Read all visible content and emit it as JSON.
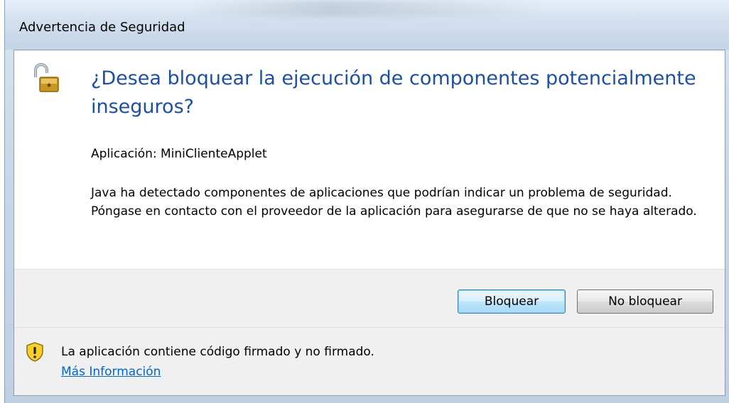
{
  "window": {
    "title": "Advertencia de Seguridad"
  },
  "dialog": {
    "heading": "¿Desea bloquear la ejecución de componentes potencialmente inseguros?",
    "application_line": "Aplicación: MiniClienteApplet",
    "description": "Java ha detectado componentes de aplicaciones que podrían indicar un problema de seguridad. Póngase en contacto con el proveedor de la aplicación para asegurarse de que no se haya alterado.",
    "icon": "padlock-open-icon"
  },
  "buttons": {
    "block_label": "Bloquear",
    "no_block_label": "No bloquear"
  },
  "footer": {
    "icon": "shield-warning-icon",
    "message": "La aplicación contiene código firmado y no firmado.",
    "link_label": "Más Información"
  },
  "colors": {
    "heading": "#1e4fa3",
    "link": "#0066cc",
    "default_button_border": "#3c7fb1"
  }
}
